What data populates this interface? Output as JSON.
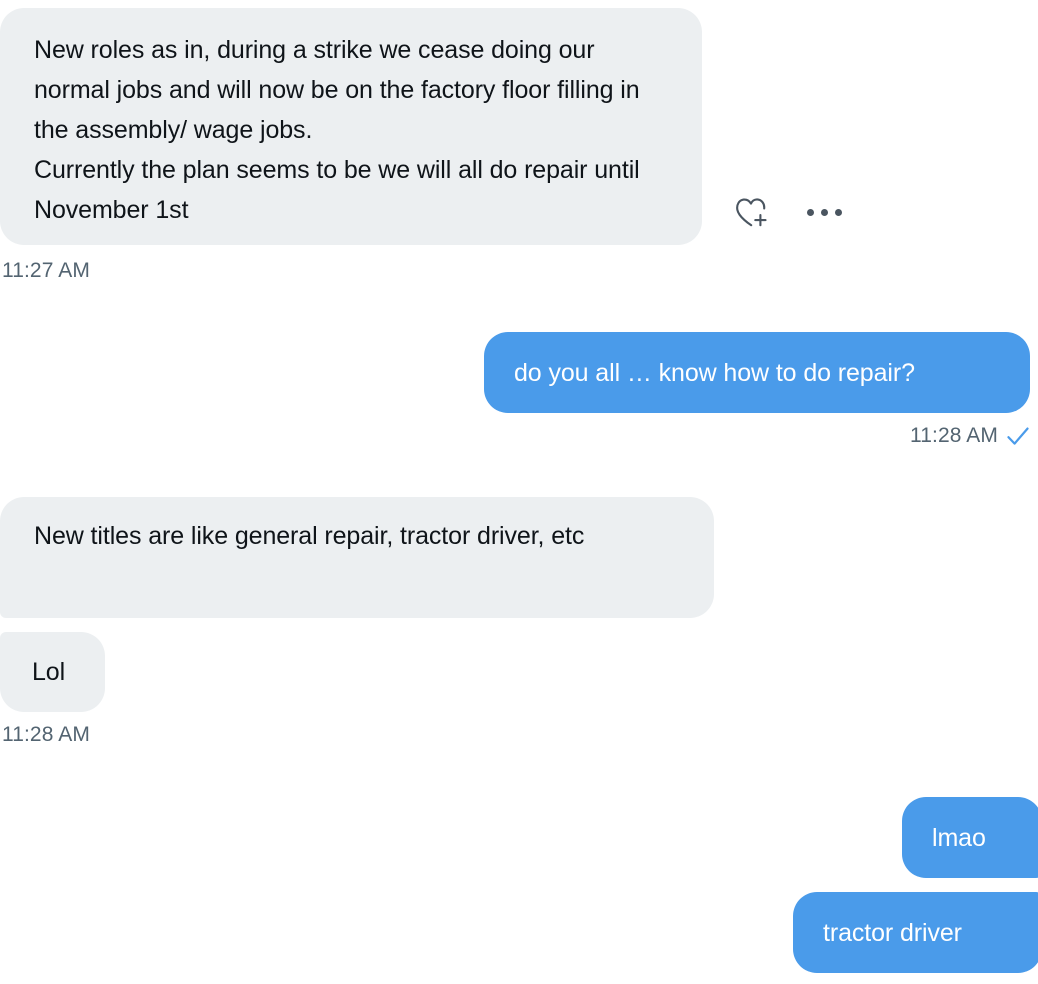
{
  "conversation": {
    "messages": [
      {
        "id": "msg-1",
        "direction": "incoming",
        "text": "New roles as in, during a strike we cease doing our normal jobs and will now be on the factory floor filling in the assembly/ wage jobs.\nCurrently the plan seems to be we will all do repair until November 1st",
        "timestamp": "11:27 AM"
      },
      {
        "id": "msg-2",
        "direction": "outgoing",
        "text": "do you all … know how to do repair?",
        "timestamp": "11:28 AM",
        "status": "sent"
      },
      {
        "id": "msg-3",
        "direction": "incoming",
        "text": "New titles are like general repair, tractor driver, etc"
      },
      {
        "id": "msg-4",
        "direction": "incoming",
        "text": "Lol",
        "timestamp": "11:28 AM"
      },
      {
        "id": "msg-5",
        "direction": "outgoing",
        "text": "lmao"
      },
      {
        "id": "msg-6",
        "direction": "outgoing",
        "text": "tractor driver"
      }
    ],
    "actions": {
      "add_reaction_icon": "heart-plus-icon",
      "more_options_icon": "more-horizontal-icon"
    },
    "icons": {
      "delivered_check": "check-icon"
    },
    "colors": {
      "incoming_bubble": "#eceff1",
      "outgoing_bubble": "#4a9bea",
      "incoming_text": "#0f1419",
      "outgoing_text": "#ffffff",
      "timestamp_text": "#536471",
      "check_accent": "#4a9bea",
      "icon_stroke": "#4a5560",
      "background": "#ffffff"
    }
  }
}
